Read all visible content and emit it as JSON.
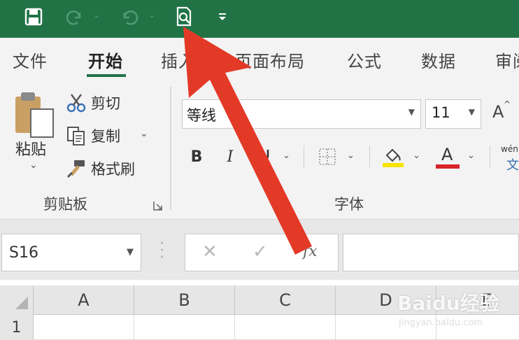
{
  "ribbon_tabs": [
    {
      "label": "文件",
      "active": false
    },
    {
      "label": "开始",
      "active": true
    },
    {
      "label": "插入",
      "active": false
    },
    {
      "label": "页面布局",
      "active": false
    },
    {
      "label": "公式",
      "active": false
    },
    {
      "label": "数据",
      "active": false
    },
    {
      "label": "审阅",
      "active": false
    }
  ],
  "quick_access": {
    "save_icon": "save-icon",
    "redo_icon": "redo-icon",
    "undo_icon": "undo-icon",
    "print_preview_icon": "print-preview-icon",
    "customize_icon": "customize-qat-icon"
  },
  "clipboard": {
    "paste_label": "粘贴",
    "cut_label": "剪切",
    "copy_label": "复制",
    "format_painter_label": "格式刷",
    "group_label": "剪贴板"
  },
  "font": {
    "font_name": "等线",
    "font_size": "11",
    "bold_label": "B",
    "italic_label": "I",
    "font_color_label": "A",
    "grow_font_label": "A",
    "phonetic_top": "wén",
    "phonetic_bottom": "文",
    "group_label": "字体"
  },
  "formula_bar": {
    "name_box": "S16",
    "cancel_symbol": "✕",
    "enter_symbol": "✓",
    "fx_label": "fx",
    "formula_value": ""
  },
  "grid": {
    "columns": [
      "A",
      "B",
      "C",
      "D",
      "E"
    ],
    "rows": [
      "1"
    ]
  },
  "watermark": {
    "main": "Baidu经验",
    "sub": "jingyan.baidu.com"
  },
  "colors": {
    "title_bar": "#217346",
    "ribbon_bg": "#f3f3f3",
    "arrow": "#e33a27",
    "highlight_yellow": "#f5e400",
    "font_red": "#d8242a"
  }
}
